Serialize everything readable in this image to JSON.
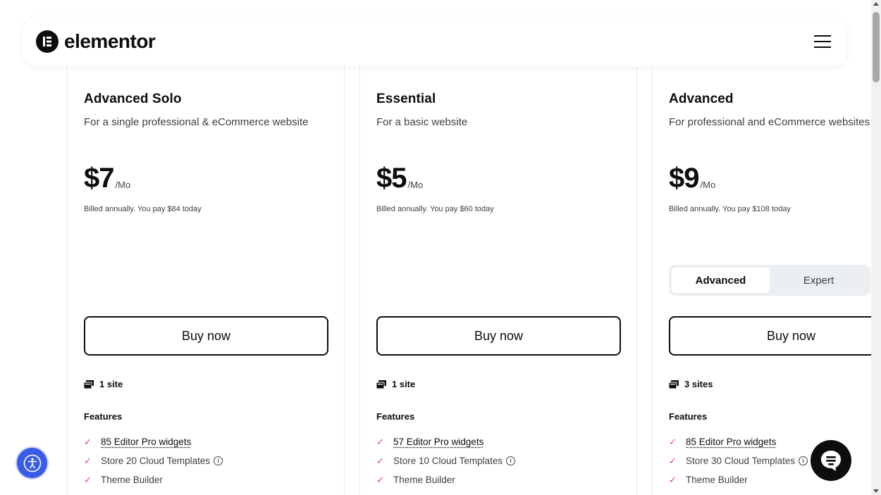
{
  "header": {
    "logo_text": "elementor",
    "menu_icon": "hamburger-icon"
  },
  "plans": [
    {
      "title": "Advanced Solo",
      "subtitle": "For a single professional & eCommerce website",
      "price": "$7",
      "per": "/Mo",
      "billed": "Billed annually. You pay $84 today",
      "buy_label": "Buy now",
      "sites": "1 site",
      "features_heading": "Features",
      "features": [
        "85 Editor Pro widgets",
        "Store 20 Cloud Templates",
        "Theme Builder"
      ]
    },
    {
      "title": "Essential",
      "subtitle": "For a basic website",
      "price": "$5",
      "per": "/Mo",
      "billed": "Billed annually. You pay $60 today",
      "buy_label": "Buy now",
      "sites": "1 site",
      "features_heading": "Features",
      "features": [
        "57 Editor Pro widgets",
        "Store 10 Cloud Templates",
        "Theme Builder"
      ]
    },
    {
      "title": "Advanced",
      "subtitle": "For professional and eCommerce websites",
      "price": "$9",
      "per": "/Mo",
      "billed": "Billed annually. You pay $108 today",
      "toggle": {
        "options": [
          "Advanced",
          "Expert"
        ],
        "selected": "Advanced"
      },
      "buy_label": "Buy now",
      "sites": "3 sites",
      "features_heading": "Features",
      "features": [
        "85 Editor Pro widgets",
        "Store 30 Cloud Templates",
        "Theme Builder"
      ]
    }
  ],
  "colors": {
    "check": "#e2349a",
    "accessibility_button": "#3b5ce6",
    "chat_button": "#0c0d0e"
  }
}
